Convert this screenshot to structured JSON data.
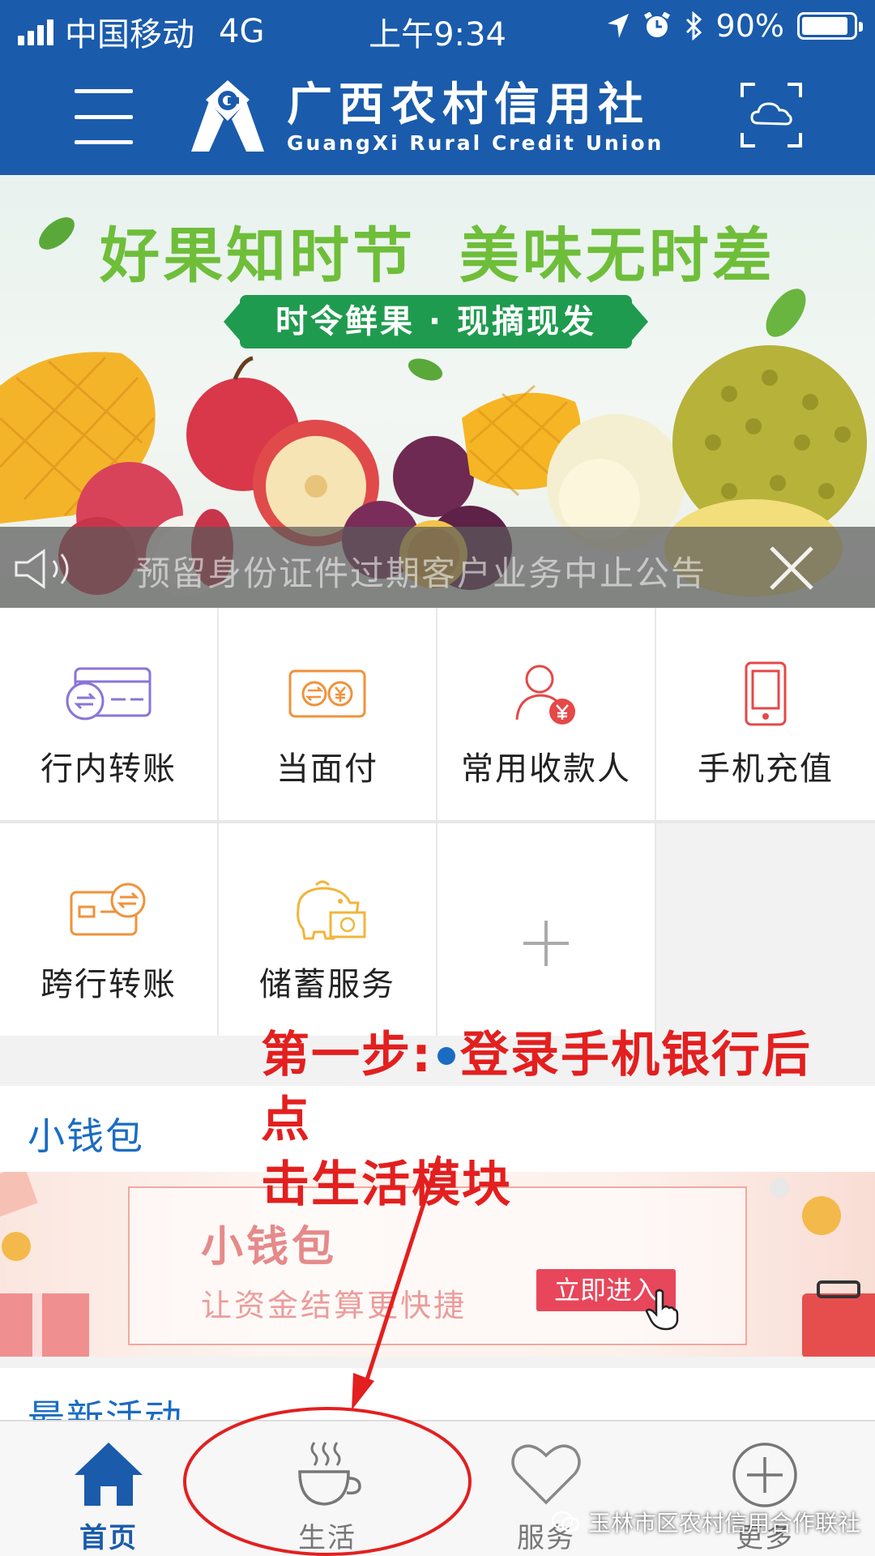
{
  "status_bar": {
    "carrier": "中国移动",
    "network": "4G",
    "time": "上午9:34",
    "battery": "90%",
    "battery_level": 0.9
  },
  "header": {
    "logo_cn": "广西农村信用社",
    "logo_en": "GuangXi Rural Credit Union"
  },
  "banner": {
    "headline_1": "好果知时节",
    "headline_2": "美味无时差",
    "tagline": "时令鲜果 · 现摘现发",
    "notice_text": "预留身份证件过期客户业务中止公告"
  },
  "services": [
    {
      "label": "行内转账",
      "icon": "transfer-card-icon"
    },
    {
      "label": "当面付",
      "icon": "face-pay-icon"
    },
    {
      "label": "常用收款人",
      "icon": "payee-icon"
    },
    {
      "label": "手机充值",
      "icon": "phone-topup-icon"
    },
    {
      "label": "跨行转账",
      "icon": "interbank-transfer-icon"
    },
    {
      "label": "储蓄服务",
      "icon": "piggy-bank-icon"
    }
  ],
  "instruction": {
    "line1_a": "第一步:",
    "line1_b": "登录手机银行后点",
    "line2": "击生活模块"
  },
  "wallet": {
    "section_title": "小钱包",
    "card_title": "小钱包",
    "card_subtitle": "让资金结算更快捷",
    "enter_button": "立即进入"
  },
  "activities": {
    "section_title": "最新活动"
  },
  "tabbar": {
    "tabs": [
      {
        "label": "首页",
        "icon": "home-icon",
        "active": true
      },
      {
        "label": "生活",
        "icon": "coffee-cup-icon",
        "active": false
      },
      {
        "label": "服务",
        "icon": "heart-icon",
        "active": false
      },
      {
        "label": "更多",
        "icon": "plus-circle-icon",
        "active": false
      }
    ]
  },
  "watermark": "玉林市区农村信用合作联社",
  "colors": {
    "brand_blue": "#1a5bab",
    "annotation_red": "#e31f1f"
  }
}
